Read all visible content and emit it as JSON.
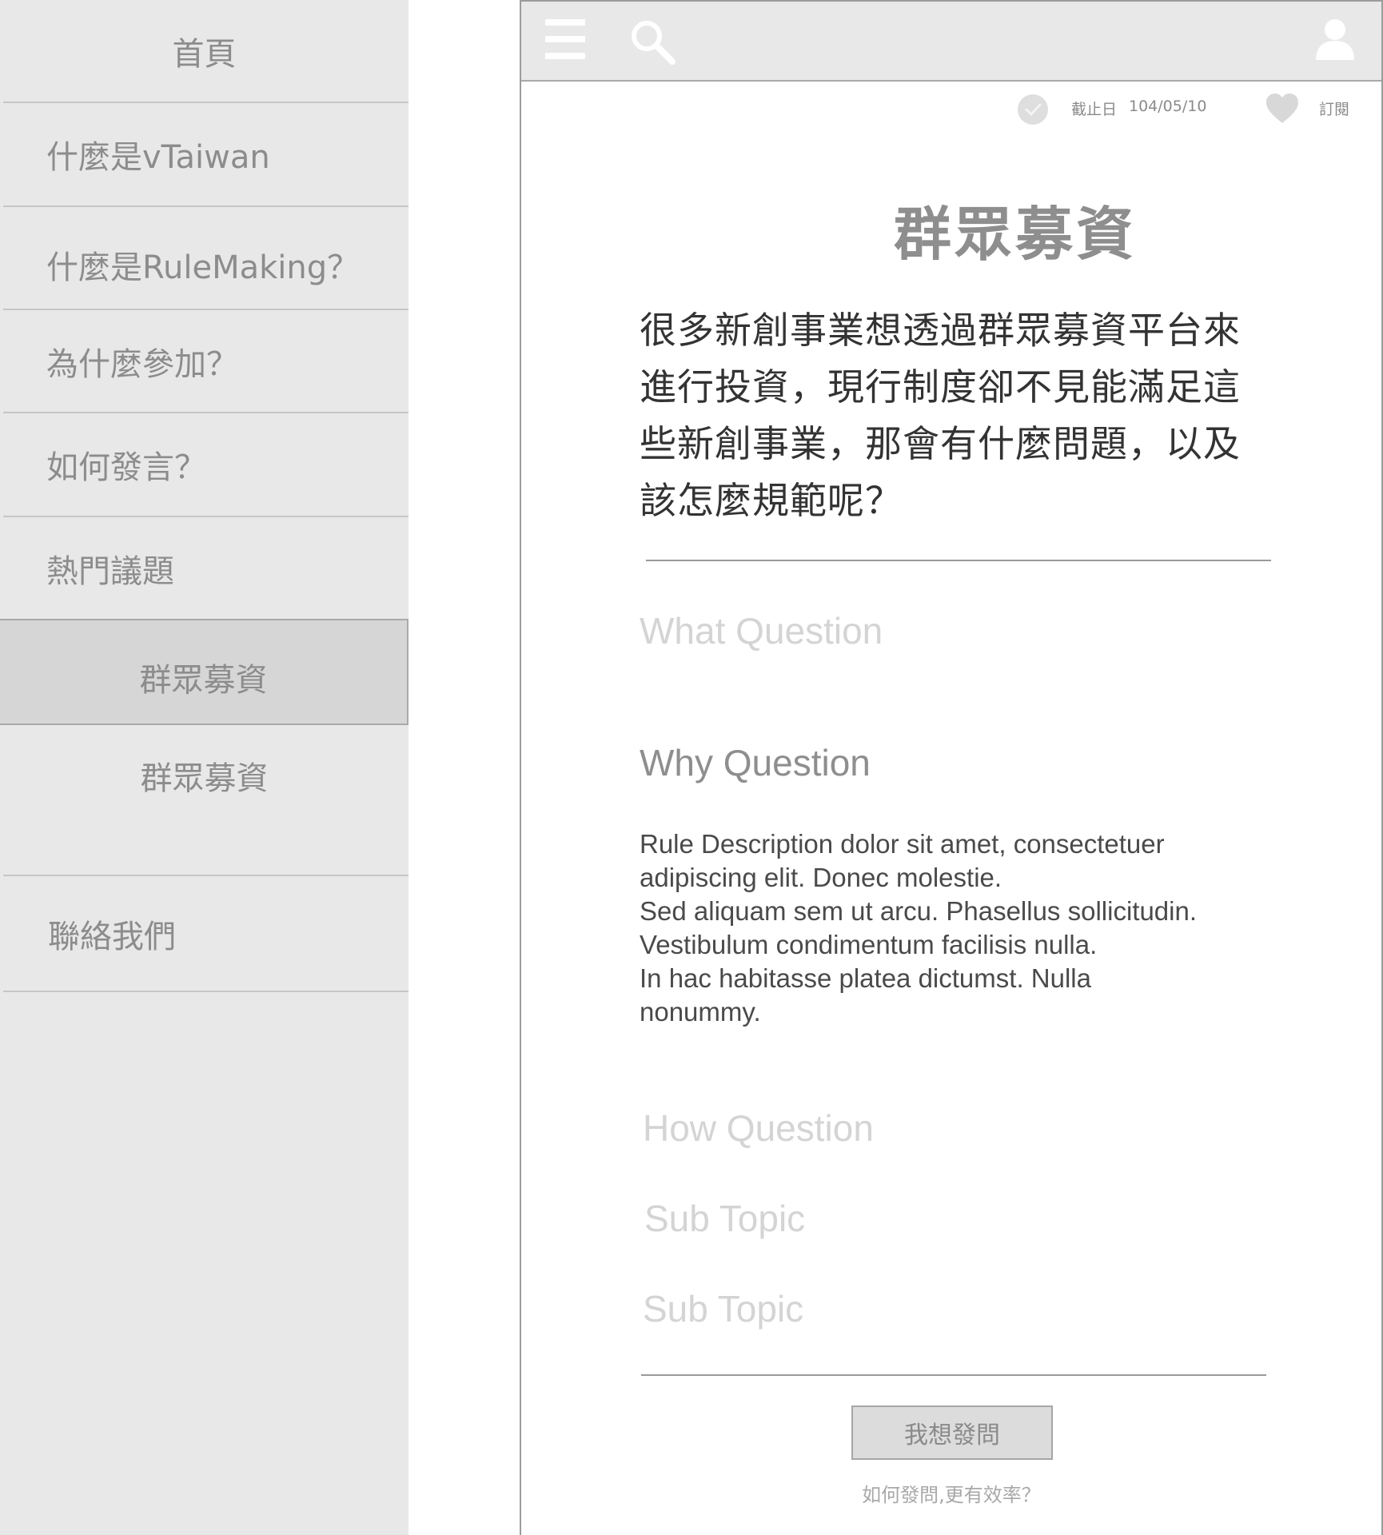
{
  "sidebar": {
    "items": [
      {
        "label": "首頁"
      },
      {
        "label": "什麼是vTaiwan"
      },
      {
        "label": "什麼是RuleMaking？"
      },
      {
        "label": "為什麼參加？"
      },
      {
        "label": "如何發言？"
      },
      {
        "label": "熱門議題"
      },
      {
        "label": "群眾募資",
        "active": true
      },
      {
        "label": "群眾募資"
      },
      {
        "label": "聯絡我們"
      }
    ]
  },
  "header": {
    "icons": [
      "hamburger-menu-icon",
      "search-icon",
      "user-icon"
    ]
  },
  "meta": {
    "deadline_label": "截止日",
    "deadline_value": "104/05/10",
    "subscribe_label": "訂閱"
  },
  "main": {
    "title": "群眾募資",
    "intro_lines": [
      "很多新創事業想透過群眾募資平台來",
      "進行投資，現行制度卻不見能滿足這",
      "些新創事業，那會有什麼問題，以及",
      "該怎麼規範呢？"
    ],
    "what_question": "What Question",
    "why_question": "Why Question",
    "description_lines": [
      "Rule Description dolor sit amet, consectetuer",
      "adipiscing elit. Donec molestie.",
      "Sed aliquam sem ut arcu. Phasellus sollicitudin.",
      "Vestibulum condimentum facilisis nulla.",
      "In hac habitasse platea dictumst. Nulla",
      "nonummy."
    ],
    "how_question": "How Question",
    "sub_topic_1": "Sub Topic",
    "sub_topic_2": "Sub Topic",
    "ask_button": "我想發問",
    "tip_link": "如何發問,更有效率？"
  },
  "colors": {
    "sidebar_bg": "#e8e8e8",
    "sidebar_active_bg": "#d6d6d6",
    "topbar_bg": "#e8e8e8",
    "muted_text": "#8c8c8c",
    "light_text": "#d4d4d4",
    "body_text": "#333333"
  }
}
